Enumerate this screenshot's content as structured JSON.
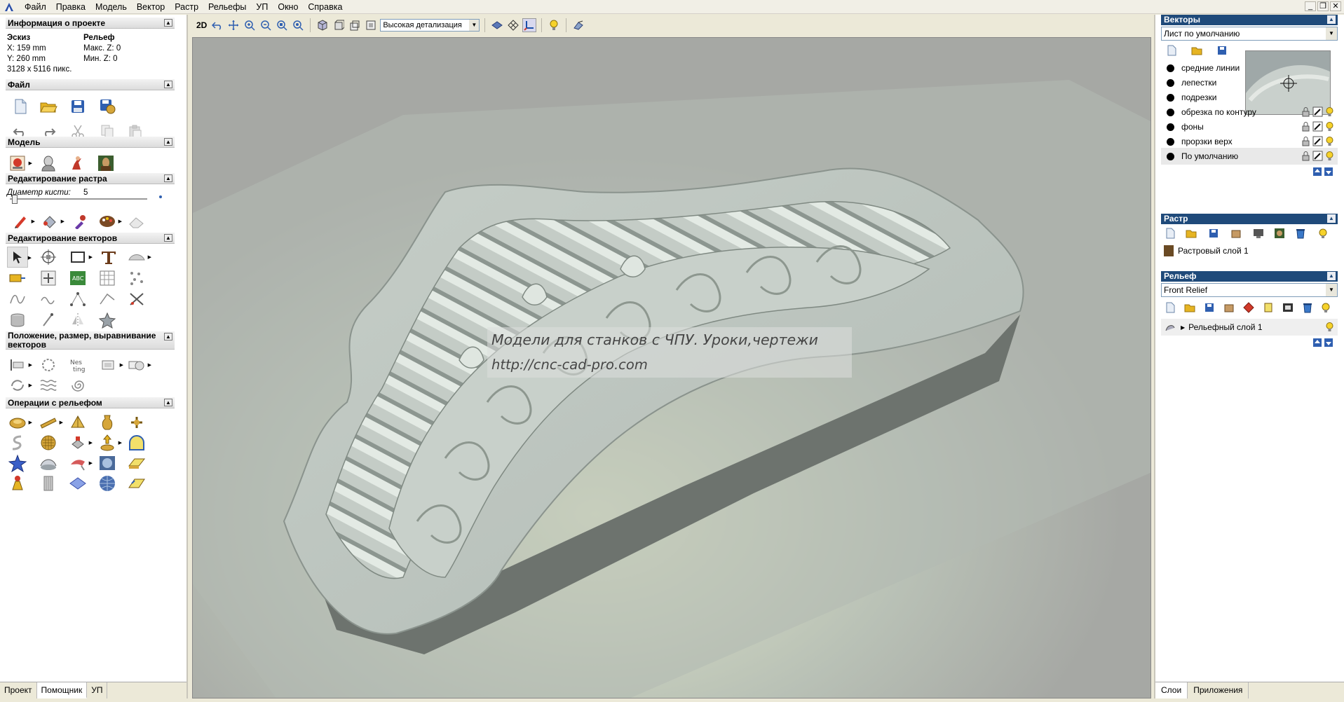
{
  "menu": [
    "Файл",
    "Правка",
    "Модель",
    "Вектор",
    "Растр",
    "Рельефы",
    "УП",
    "Окно",
    "Справка"
  ],
  "left": {
    "project_info": {
      "title": "Информация о проекте",
      "col1_title": "Эскиз",
      "x": "X: 159 mm",
      "y": "Y: 260 mm",
      "pixels": "3128 x 5116 пикс.",
      "col2_title": "Рельеф",
      "max_z": "Макс. Z: 0",
      "min_z": "Мин. Z: 0"
    },
    "sections": {
      "file": "Файл",
      "model": "Модель",
      "raster_edit": "Редактирование растра",
      "vector_edit": "Редактирование векторов",
      "position": "Положение, размер, выравнивание векторов",
      "relief_ops": "Операции с рельефом"
    },
    "brush_label": "Диаметр кисти:",
    "brush_value": "5",
    "tabs": [
      "Проект",
      "Помощник",
      "УП"
    ]
  },
  "toolbar": {
    "mode_2d": "2D",
    "detail": "Высокая детализация"
  },
  "viewport": {
    "watermark_line1": "Модели для станков с ЧПУ. Уроки,чертежи",
    "watermark_line2": "http://cnc-cad-pro.com"
  },
  "right": {
    "vectors": {
      "title": "Векторы",
      "sheet": "Лист по умолчанию",
      "layers": [
        "средние линии",
        "лепестки",
        "подрезки",
        "обрезка по контуру",
        "фоны",
        "прорзки верх",
        "По умолчанию"
      ]
    },
    "raster": {
      "title": "Растр",
      "layer": "Растровый слой 1"
    },
    "relief": {
      "title": "Рельеф",
      "combo": "Front Relief",
      "layer": "Рельефный слой 1"
    },
    "tabs": [
      "Слои",
      "Приложения"
    ]
  },
  "colors": {
    "panel_header": "#1f4a7a",
    "viewport_bg": "#a6a8a4",
    "model_surface": "#c3cbc4"
  }
}
